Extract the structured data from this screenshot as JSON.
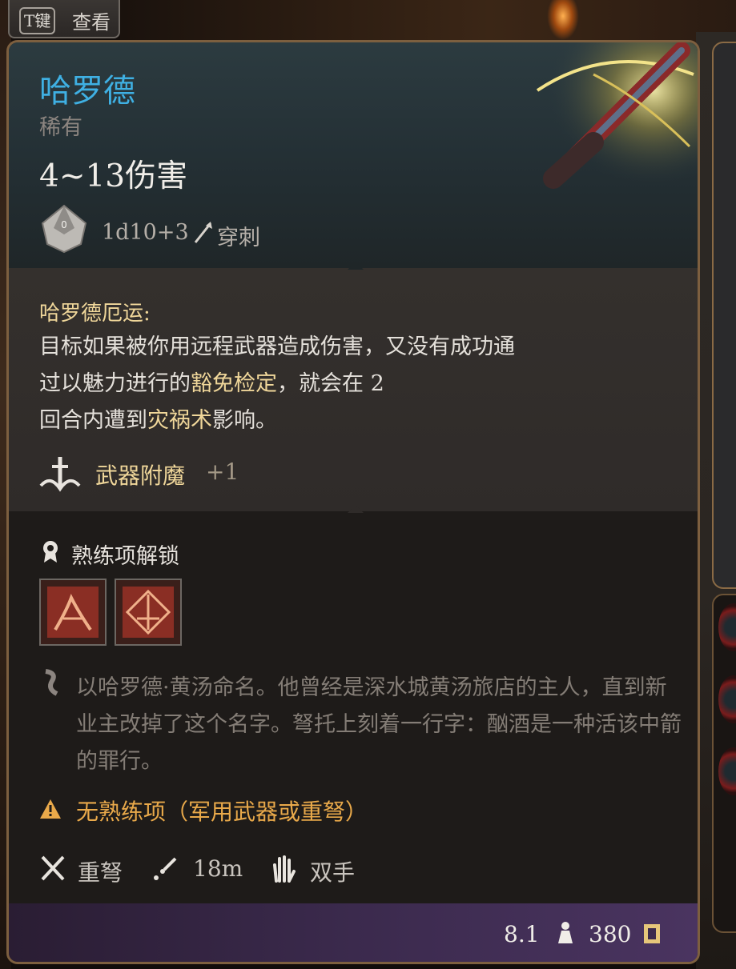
{
  "hotkey": {
    "key": "T键",
    "label": "查看"
  },
  "item": {
    "name": "哈罗德",
    "rarity": "稀有",
    "damage": "4~13伤害",
    "dice_roll": "1d10+3",
    "damage_type": "穿刺"
  },
  "passive": {
    "title": "哈罗德厄运:",
    "desc_1": "目标如果被你用远程武器造成伤害，又没有成功通",
    "desc_2a": "过以魅力进行的",
    "desc_2b": "豁免检定",
    "desc_2c": "，就会在 2",
    "desc_3a": "回合内遭到",
    "desc_3b": "灾祸术",
    "desc_3c": "影响。"
  },
  "enchantment": {
    "label": "武器附魔",
    "value": "+1"
  },
  "proficiency": {
    "title": "熟练项解锁"
  },
  "lore": "以哈罗德·黄汤命名。他曾经是深水城黄汤旅店的主人，直到新业主改掉了这个名字。弩托上刻着一行字：酗酒是一种活该中箭的罪行。",
  "warning": "无熟练项（军用武器或重弩）",
  "stats": {
    "weapon_type": "重弩",
    "range": "18m",
    "hands": "双手"
  },
  "footer": {
    "weight": "8.1",
    "value": "380"
  },
  "colors": {
    "title": "#3fb0e3",
    "highlight": "#f0d79a",
    "warning": "#e9a94a",
    "border": "#7d5f3f"
  }
}
